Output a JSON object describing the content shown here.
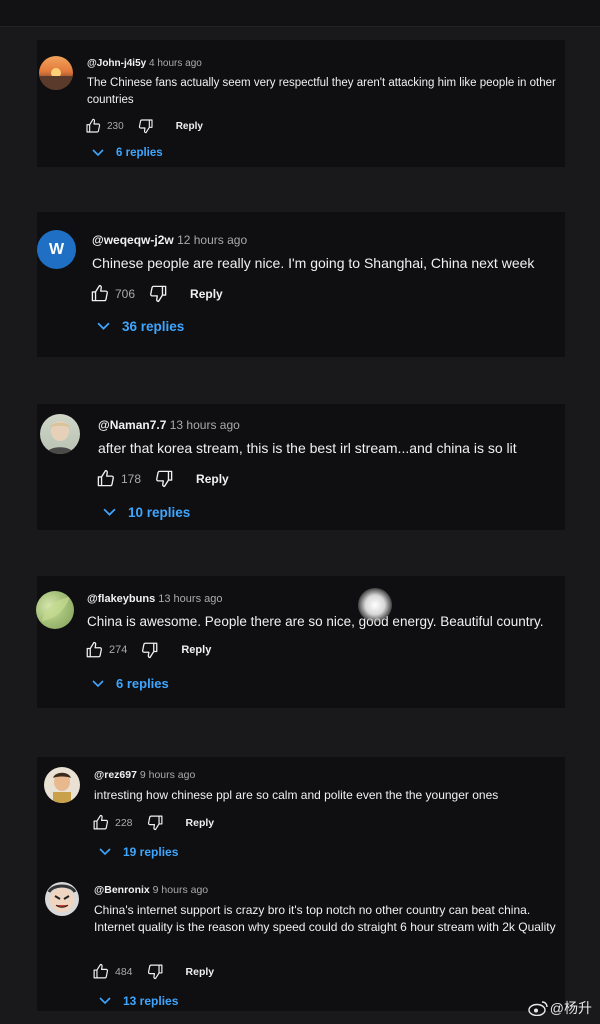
{
  "comments": [
    {
      "handle": "@John-j4i5y",
      "time": "4 hours ago",
      "text": "The Chinese fans actually seem very respectful they aren't attacking him like people in other countries",
      "likes": "230",
      "reply": "Reply",
      "replies": "6 replies",
      "avatar": "sunset-avatar"
    },
    {
      "handle": "@weqeqw-j2w",
      "time": "12 hours ago",
      "text": "Chinese people are really nice. I'm going to Shanghai, China next week",
      "likes": "706",
      "reply": "Reply",
      "replies": "36 replies",
      "avatar_letter": "W",
      "avatar_color": "#1f6fc5"
    },
    {
      "handle": "@Naman7.7",
      "time": "13 hours ago",
      "text": "after that korea stream, this is the best irl stream...and china is so lit",
      "likes": "178",
      "reply": "Reply",
      "replies": "10 replies",
      "avatar": "portrait-avatar"
    },
    {
      "handle": "@flakeybuns",
      "time": "13 hours ago",
      "text": "China is awesome. People there are so nice, good energy. Beautiful country.",
      "likes": "274",
      "reply": "Reply",
      "replies": "6 replies",
      "avatar": "green-avatar"
    },
    {
      "handle": "@rez697",
      "time": "9 hours ago",
      "text": "intresting how chinese ppl are so calm and polite even the the younger ones",
      "likes": "228",
      "reply": "Reply",
      "replies": "19 replies",
      "avatar": "child-avatar"
    },
    {
      "handle": "@Benronix",
      "time": "9 hours ago",
      "text": "China's internet support is crazy bro it's top notch no other country can beat china. Internet quality is the reason why speed could do straight 6 hour stream with 2k Quality",
      "likes": "484",
      "reply": "Reply",
      "replies": "13 replies",
      "avatar": "cartoon-avatar"
    }
  ],
  "watermark": "@杨升",
  "colors": {
    "accent_blue": "#3ea6ff",
    "card_bg": "#0f0f11",
    "page_bg": "#19191b"
  }
}
